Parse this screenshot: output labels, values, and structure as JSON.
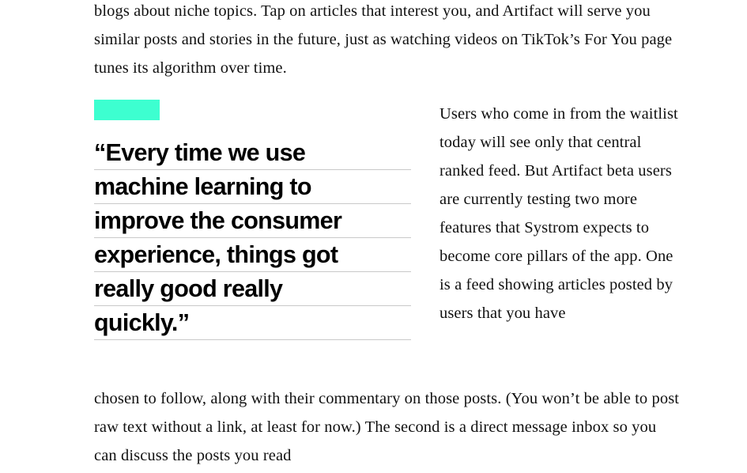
{
  "colors": {
    "accent_bar": "#3dffd0",
    "rule": "#c9c9c9",
    "text": "#111111",
    "background": "#ffffff"
  },
  "article": {
    "paragraph_top": "blogs about niche topics. Tap on articles that interest you, and Artifact will serve you similar posts and stories in the future, just as watching videos on TikTok’s For You page tunes its algorithm over time.",
    "pullquote": {
      "lines": [
        "“Every time we use",
        "machine learning to",
        "improve the consumer",
        "experience, things got",
        "really good really",
        "quickly.”"
      ],
      "full_text": "“Every time we use machine learning to improve the consumer experience, things got really good really quickly.”"
    },
    "side_column": "Users who come in from the waitlist today will see only that central ranked feed. But Artifact beta users are currently testing two more features that Systrom expects to become core pillars of the app. One is a feed showing articles posted by users that you have",
    "paragraph_bottom": "chosen to follow, along with their commentary on those posts. (You won’t be able to post raw text without a link, at least for now.) The second is a direct message inbox so you can discuss the posts you read"
  }
}
